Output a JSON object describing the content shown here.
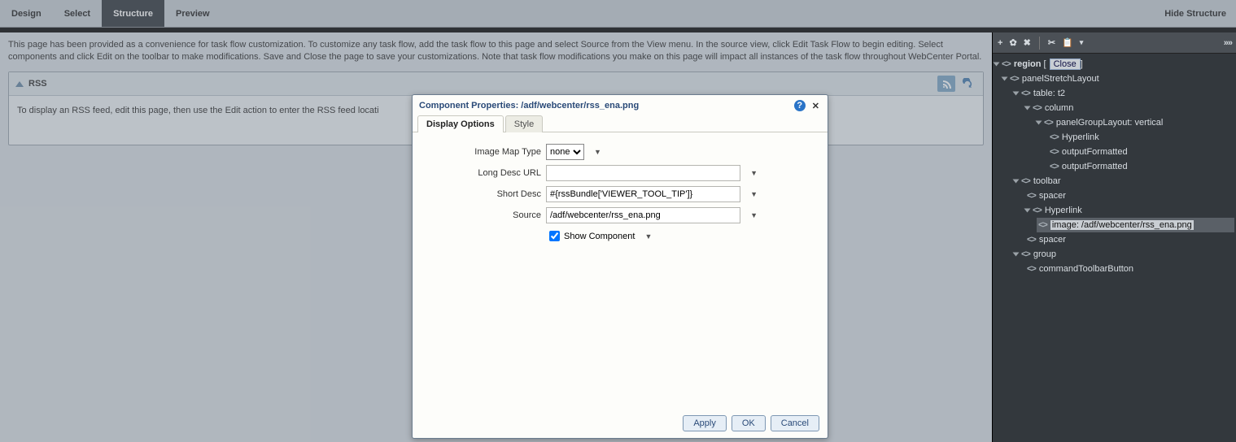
{
  "tabs": {
    "design": "Design",
    "select": "Select",
    "structure": "Structure",
    "preview": "Preview",
    "hide": "Hide Structure"
  },
  "info": "This page has been provided as a convenience for task flow customization. To customize any task flow, add the task flow to this page and select Source from the View menu. In the source view, click Edit Task Flow to begin editing. Select components and click Edit on the toolbar to make modifications. Save and Close the page to save your customizations. Note that task flow modifications you make on this page will impact all instances of the task flow throughout WebCenter Portal.",
  "rss": {
    "title": "RSS",
    "body": "To display an RSS feed, edit this page, then use the Edit action to enter the RSS feed locati"
  },
  "dialog": {
    "title": "Component Properties: /adf/webcenter/rss_ena.png",
    "tabs": {
      "display": "Display Options",
      "style": "Style"
    },
    "labels": {
      "mapType": "Image Map Type",
      "longDesc": "Long Desc URL",
      "shortDesc": "Short Desc",
      "source": "Source",
      "show": "Show Component"
    },
    "values": {
      "mapType": "none",
      "longDesc": "",
      "shortDesc": "#{rssBundle['VIEWER_TOOL_TIP']}",
      "source": "/adf/webcenter/rss_ena.png",
      "show": true
    },
    "buttons": {
      "apply": "Apply",
      "ok": "OK",
      "cancel": "Cancel"
    }
  },
  "tree": {
    "close": "Close",
    "n0": "region",
    "n1": "panelStretchLayout",
    "n2": "table: t2",
    "n3": "column",
    "n4": "panelGroupLayout: vertical",
    "n5": "Hyperlink",
    "n6": "outputFormatted",
    "n7": "outputFormatted",
    "n8": "toolbar",
    "n9": "spacer",
    "n10": "Hyperlink",
    "n11": "image: /adf/webcenter/rss_ena.png",
    "n12": "spacer",
    "n13": "group",
    "n14": "commandToolbarButton"
  }
}
